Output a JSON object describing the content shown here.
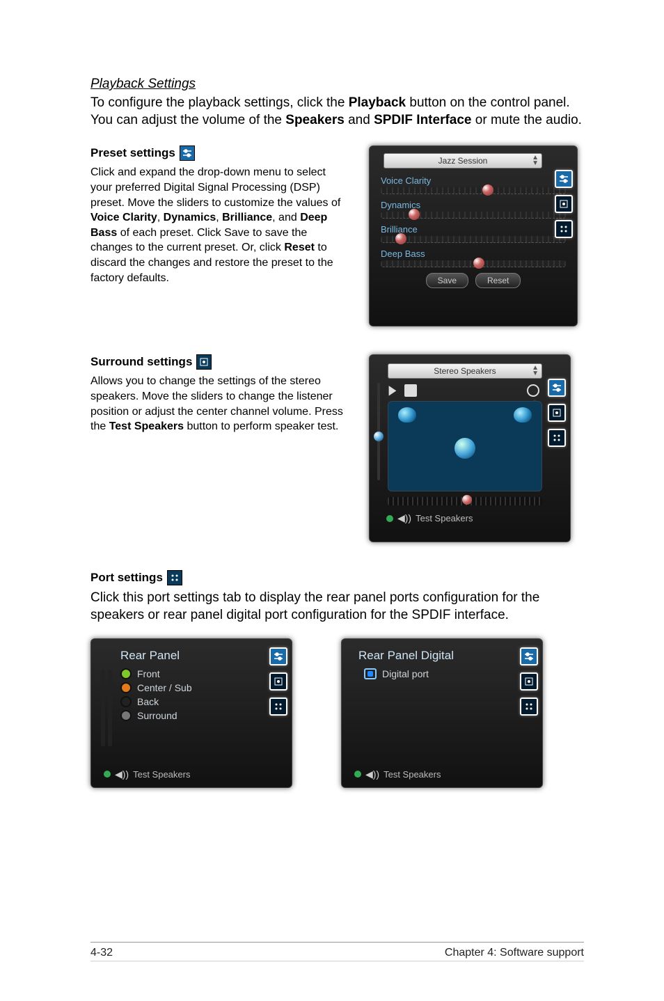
{
  "section_title": "Playback Settings",
  "intro_a": "To configure the playback settings, click the ",
  "intro_b": " button on the control panel. You can adjust the volume of the ",
  "intro_c": " and ",
  "intro_d": " or mute the audio.",
  "intro_bold1": "Playback",
  "intro_bold2": "Speakers",
  "intro_bold3": "SPDIF Interface",
  "preset": {
    "heading": "Preset settings",
    "body_a": "Click and expand the drop-down menu to select your preferred Digital Signal Processing (DSP) preset. Move the sliders to customize the values of ",
    "b1": "Voice Clarity",
    "sep1": ", ",
    "b2": "Dynamics",
    "sep2": ", ",
    "b3": "Brilliance",
    "sep3": ", and ",
    "b4": "Deep Bass",
    "body_b": " of each preset. Click Save to save the changes to the current preset. Or, click ",
    "b5": "Reset",
    "body_c": " to discard the changes and restore the preset to the factory defaults.",
    "dropdown": "Jazz Session",
    "sliders": {
      "voice": "Voice Clarity",
      "dynamics": "Dynamics",
      "brilliance": "Brilliance",
      "deep": "Deep Bass"
    },
    "save": "Save",
    "reset": "Reset"
  },
  "surround": {
    "heading": "Surround settings",
    "body_a": "Allows you to change the settings of the stereo speakers. Move the sliders to change the listener position or adjust the center channel volume. Press the ",
    "b1": "Test Speakers",
    "body_b": " button to perform speaker test.",
    "dropdown": "Stereo Speakers",
    "test": "Test Speakers"
  },
  "port": {
    "heading": "Port settings",
    "body": "Click this port settings tab to display the rear panel ports configuration for the speakers or rear panel digital port configuration for the SPDIF interface.",
    "left": {
      "title": "Rear Panel",
      "front": "Front",
      "center": "Center / Sub",
      "back": "Back",
      "surround": "Surround",
      "test": "Test Speakers"
    },
    "right": {
      "title": "Rear Panel Digital",
      "digital": "Digital port",
      "test": "Test Speakers"
    }
  },
  "footer": {
    "left": "4-32",
    "right": "Chapter 4: Software support"
  }
}
